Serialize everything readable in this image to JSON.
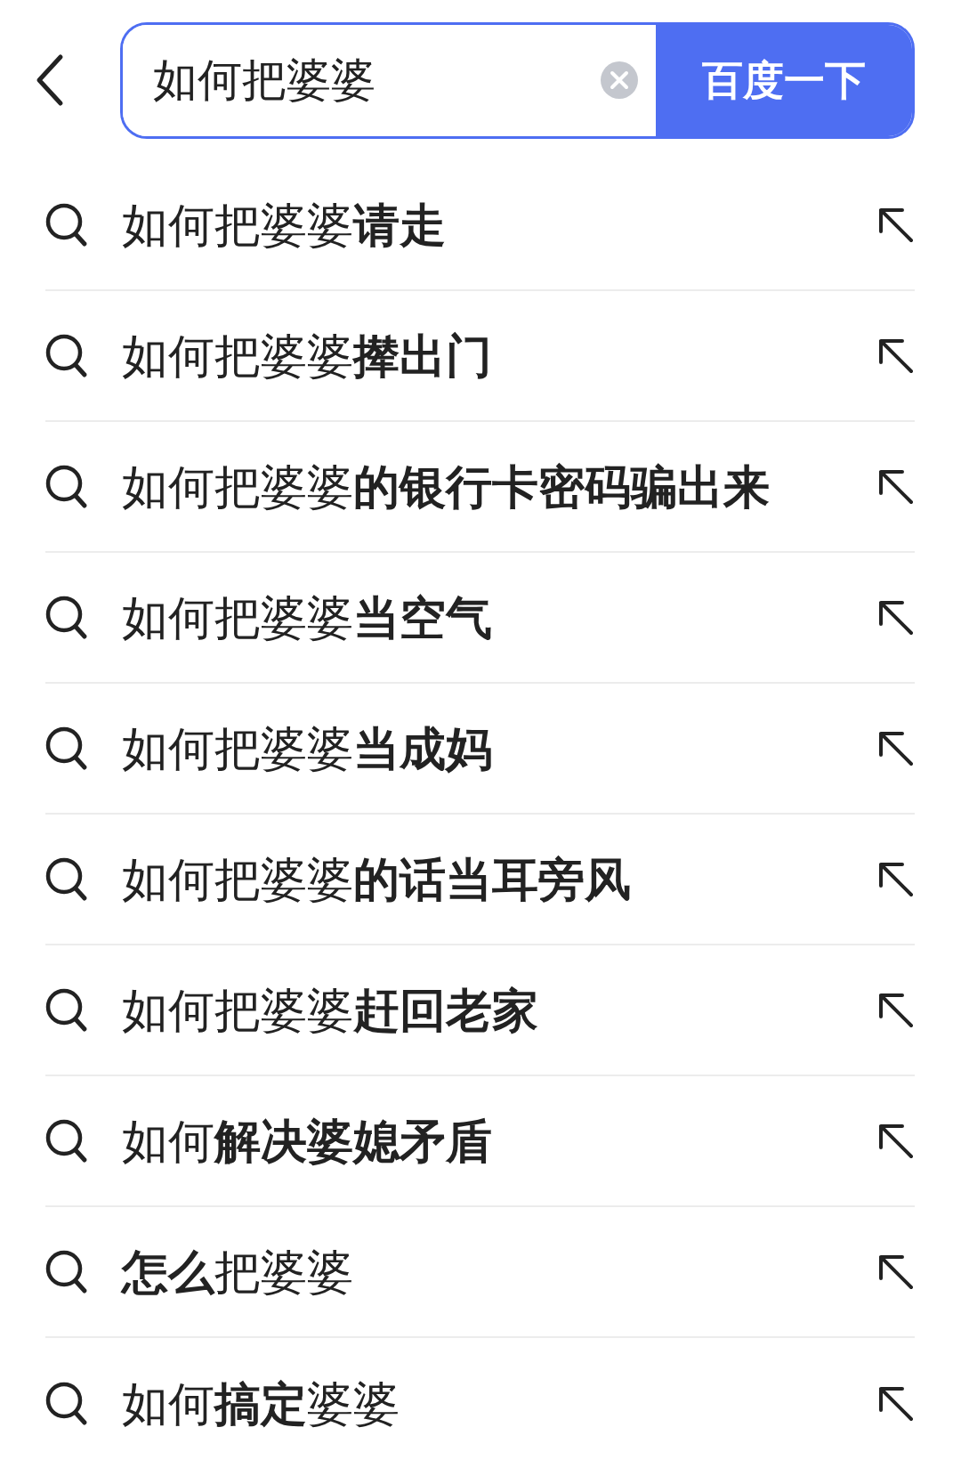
{
  "search": {
    "value": "如何把婆婆",
    "button": "百度一下"
  },
  "suggestions": [
    {
      "text": "如何把婆婆**请走**"
    },
    {
      "text": "如何把婆婆**撵出门**"
    },
    {
      "text": "如何把婆婆**的银行卡密码骗出来**"
    },
    {
      "text": "如何把婆婆**当空气**"
    },
    {
      "text": "如何把婆婆**当成妈**"
    },
    {
      "text": "如何把婆婆**的话当耳旁风**"
    },
    {
      "text": "如何把婆婆**赶回老家**"
    },
    {
      "text": "如何**解决婆媳矛盾**"
    },
    {
      "text": "**怎么**把婆婆"
    },
    {
      "text": "如何**搞定**婆婆"
    }
  ]
}
